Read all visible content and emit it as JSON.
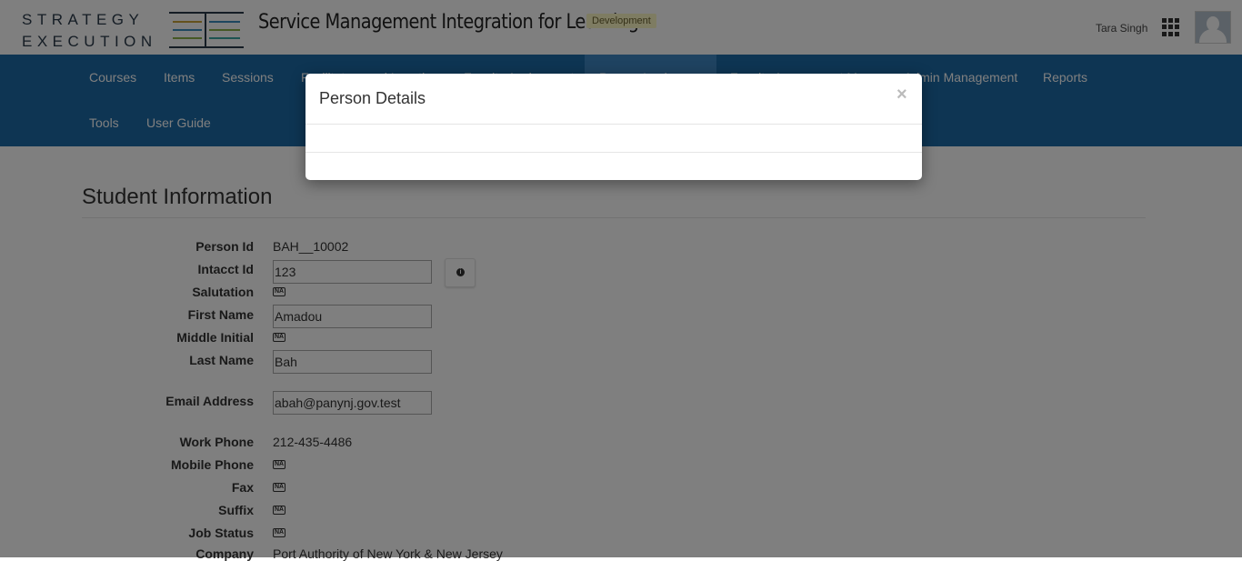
{
  "header": {
    "logo_line1": "STRATEGY",
    "logo_line2": "EXECUTION",
    "app_title": "Service Management Integration for Learning",
    "environment_badge": "Development",
    "user_name": "Tara Singh"
  },
  "nav": {
    "items": [
      "Courses",
      "Items",
      "Sessions",
      "Facilitators and Locations",
      "Faculty Assignment",
      "Person Lookup",
      "Faculty Assessment Management",
      "Admin Management",
      "Reports",
      "Tools",
      "User Guide"
    ],
    "active": "Person Lookup"
  },
  "page": {
    "title": "Student Information"
  },
  "fields": {
    "person_id": {
      "label": "Person Id",
      "value": "BAH__10002"
    },
    "intacct_id": {
      "label": "Intacct Id",
      "value": "123"
    },
    "salutation": {
      "label": "Salutation",
      "value": "NA"
    },
    "first_name": {
      "label": "First Name",
      "value": "Amadou"
    },
    "middle_initial": {
      "label": "Middle Initial",
      "value": "NA"
    },
    "last_name": {
      "label": "Last Name",
      "value": "Bah"
    },
    "email": {
      "label": "Email Address",
      "value": "abah@panynj.gov.test"
    },
    "work_phone": {
      "label": "Work Phone",
      "value": "212-435-4486"
    },
    "mobile_phone": {
      "label": "Mobile Phone",
      "value": "NA"
    },
    "fax": {
      "label": "Fax",
      "value": "NA"
    },
    "suffix": {
      "label": "Suffix",
      "value": "NA"
    },
    "job_status": {
      "label": "Job Status",
      "value": "NA"
    },
    "company": {
      "label": "Company",
      "value": "Port Authority of New York & New Jersey"
    }
  },
  "modal": {
    "title": "Person Details",
    "close_glyph": "×"
  },
  "icons": {
    "info": "info-circle-icon",
    "apps": "grid-apps-icon",
    "avatar": "user-avatar-icon"
  },
  "colors": {
    "nav_bg": "#1d6aa6",
    "nav_active": "#3f86c3",
    "badge_bg": "#fcf8c4"
  }
}
